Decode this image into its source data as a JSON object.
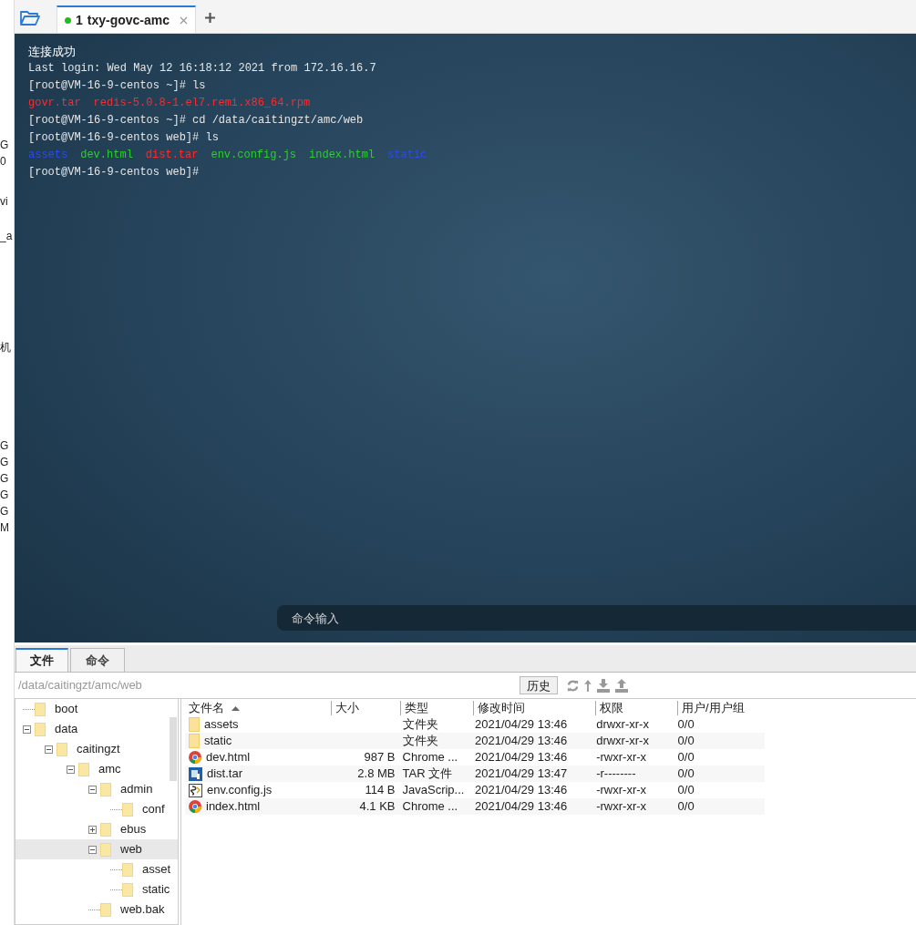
{
  "side_fragments": [
    "G",
    "0",
    "vi",
    "_a",
    "机",
    "G",
    "G",
    "G",
    "G",
    "G",
    "M"
  ],
  "tabs": [
    {
      "number": "1",
      "title": "txy-govc-amc",
      "connected": true,
      "selected": true
    }
  ],
  "terminal": {
    "lines": [
      {
        "segments": [
          {
            "text": "连接成功",
            "color": "#ffffff"
          }
        ]
      },
      {
        "segments": [
          {
            "text": "Last login: Wed May 12 16:18:12 2021 from 172.16.16.7",
            "color": "#e6e6e6"
          }
        ]
      },
      {
        "segments": [
          {
            "text": "[root@VM-16-9-centos ~]# ls",
            "color": "#e6e6e6"
          }
        ]
      },
      {
        "segments": [
          {
            "text": "govr.tar",
            "color": "#ff2a2a"
          },
          {
            "text": "redis-5.0.8-1.el7.remi.x86_64.rpm",
            "color": "#ff2a2a"
          }
        ]
      },
      {
        "segments": [
          {
            "text": "[root@VM-16-9-centos ~]# cd /data/caitingzt/amc/web",
            "color": "#e6e6e6"
          }
        ]
      },
      {
        "segments": [
          {
            "text": "[root@VM-16-9-centos web]# ls",
            "color": "#e6e6e6"
          }
        ]
      },
      {
        "segments": [
          {
            "text": "assets",
            "color": "#2a4bf0"
          },
          {
            "text": "dev.html",
            "color": "#2ccf2c"
          },
          {
            "text": "dist.tar",
            "color": "#ff2a2a"
          },
          {
            "text": "env.config.js",
            "color": "#2ccf2c"
          },
          {
            "text": "index.html",
            "color": "#2ccf2c"
          },
          {
            "text": "static",
            "color": "#2a4bf0"
          }
        ]
      },
      {
        "segments": [
          {
            "text": "[root@VM-16-9-centos web]#",
            "color": "#e6e6e6"
          }
        ]
      }
    ]
  },
  "command_input": {
    "placeholder": "命令输入"
  },
  "bottom_tabs": [
    {
      "label": "文件",
      "selected": true
    },
    {
      "label": "命令",
      "selected": false
    }
  ],
  "path": "/data/caitingzt/amc/web",
  "history_button": "历史",
  "tree": [
    {
      "name": "boot"
    },
    {
      "name": "data",
      "expanded": true,
      "children": [
        {
          "name": "caitingzt",
          "expanded": true,
          "children": [
            {
              "name": "amc",
              "expanded": true,
              "children": [
                {
                  "name": "admin",
                  "expanded": true,
                  "children": [
                    {
                      "name": "conf"
                    }
                  ]
                },
                {
                  "name": "ebus",
                  "expanded": false
                },
                {
                  "name": "web",
                  "expanded": true,
                  "selected": true,
                  "children": [
                    {
                      "name": "asset"
                    },
                    {
                      "name": "static"
                    }
                  ]
                },
                {
                  "name": "web.bak"
                }
              ]
            }
          ]
        }
      ]
    }
  ],
  "table": {
    "columns": [
      "文件名",
      "大小",
      "类型",
      "修改时间",
      "权限",
      "用户/用户组"
    ],
    "rows": [
      {
        "kind": "folder",
        "name": "assets",
        "size": "",
        "type": "文件夹",
        "modified": "2021/04/29 13:46",
        "permissions": "drwxr-xr-x",
        "owner": "0/0"
      },
      {
        "kind": "folder",
        "name": "static",
        "size": "",
        "type": "文件夹",
        "modified": "2021/04/29 13:46",
        "permissions": "drwxr-xr-x",
        "owner": "0/0"
      },
      {
        "kind": "browser",
        "name": "dev.html",
        "size": "987 B",
        "type": "Chrome ...",
        "modified": "2021/04/29 13:46",
        "permissions": "-rwxr-xr-x",
        "owner": "0/0"
      },
      {
        "kind": "archive",
        "name": "dist.tar",
        "size": "2.8 MB",
        "type": "TAR 文件",
        "modified": "2021/04/29 13:47",
        "permissions": "-r--------",
        "owner": "0/0"
      },
      {
        "kind": "script",
        "name": "env.config.js",
        "size": "114 B",
        "type": "JavaScrip...",
        "modified": "2021/04/29 13:46",
        "permissions": "-rwxr-xr-x",
        "owner": "0/0"
      },
      {
        "kind": "browser",
        "name": "index.html",
        "size": "4.1 KB",
        "type": "Chrome ...",
        "modified": "2021/04/29 13:46",
        "permissions": "-rwxr-xr-x",
        "owner": "0/0"
      }
    ]
  }
}
